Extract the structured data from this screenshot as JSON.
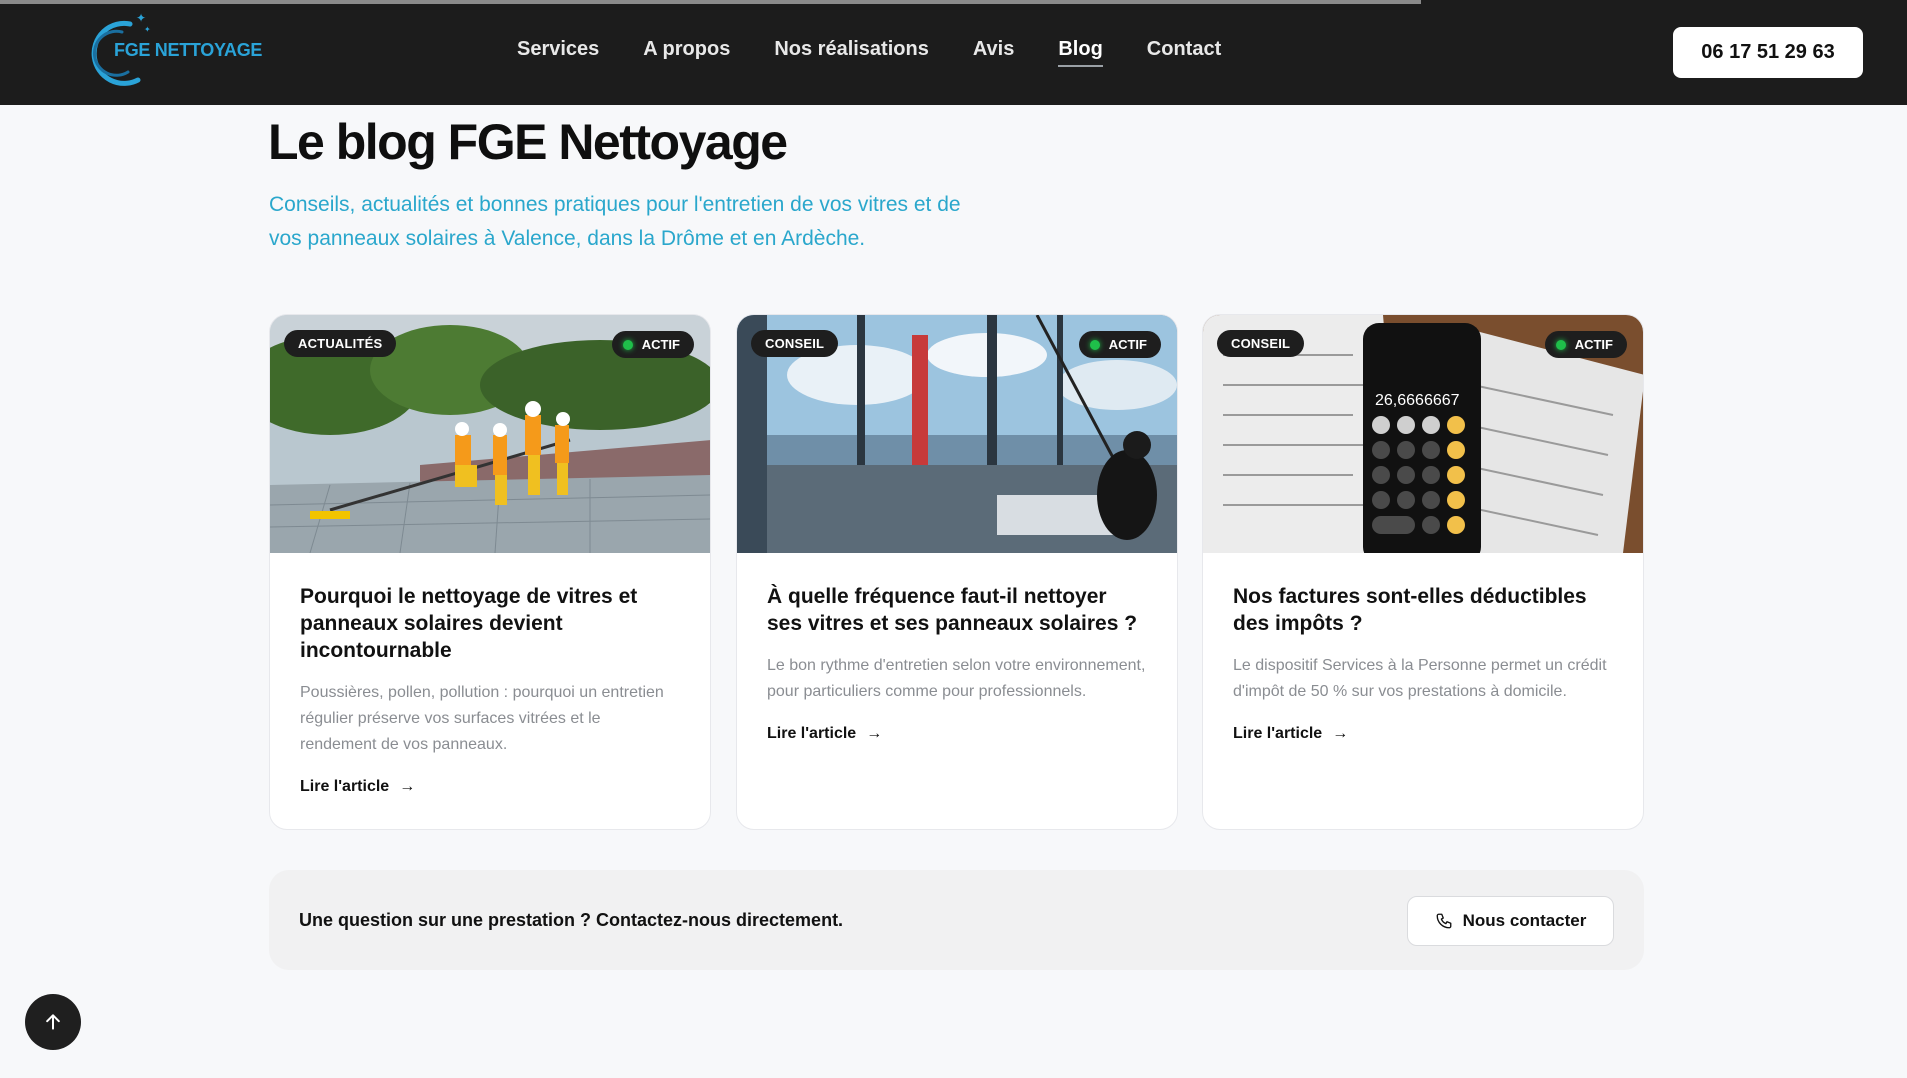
{
  "header": {
    "logo_text": "FGE NETTOYAGE",
    "nav": [
      {
        "label": "Services"
      },
      {
        "label": "A propos"
      },
      {
        "label": "Nos réalisations"
      },
      {
        "label": "Avis"
      },
      {
        "label": "Blog",
        "active": true
      },
      {
        "label": "Contact"
      }
    ],
    "phone": "06 17 51 29 63"
  },
  "hero": {
    "title": "Le blog FGE Nettoyage",
    "subtitle": "Conseils, actualités et bonnes pratiques pour l'entretien de vos vitres et de vos panneaux solaires à Valence, dans la Drôme et en Ardèche."
  },
  "cards": [
    {
      "category": "ACTUALITÉS",
      "status": "ACTIF",
      "title": "Pourquoi le nettoyage de vitres et panneaux solaires devient incontournable",
      "description": "Poussières, pollen, pollution : pourquoi un entretien régulier préserve vos surfaces vitrées et le rendement de vos panneaux.",
      "link": "Lire l'article"
    },
    {
      "category": "CONSEIL",
      "status": "ACTIF",
      "title": "À quelle fréquence faut-il nettoyer ses vitres et ses panneaux solaires ?",
      "description": "Le bon rythme d'entretien selon votre environnement, pour particuliers comme pour professionnels.",
      "link": "Lire l'article"
    },
    {
      "category": "CONSEIL",
      "status": "ACTIF",
      "title": "Nos factures sont-elles déductibles des impôts ?",
      "description": "Le dispositif Services à la Personne permet un crédit d'impôt de 50 % sur vos prestations à domicile.",
      "link": "Lire l'article",
      "calculator_display": "26,6666667"
    }
  ],
  "cta": {
    "text": "Une question sur une prestation ? Contactez-nous directement.",
    "button": "Nous contacter"
  },
  "colors": {
    "header_bg": "#1c1c1c",
    "accent": "#2aa7cc",
    "badge_dot": "#1fbf4a"
  },
  "icons": {
    "arrow": "arrow-right-icon",
    "phone": "phone-icon",
    "scroll": "arrow-up-icon"
  }
}
